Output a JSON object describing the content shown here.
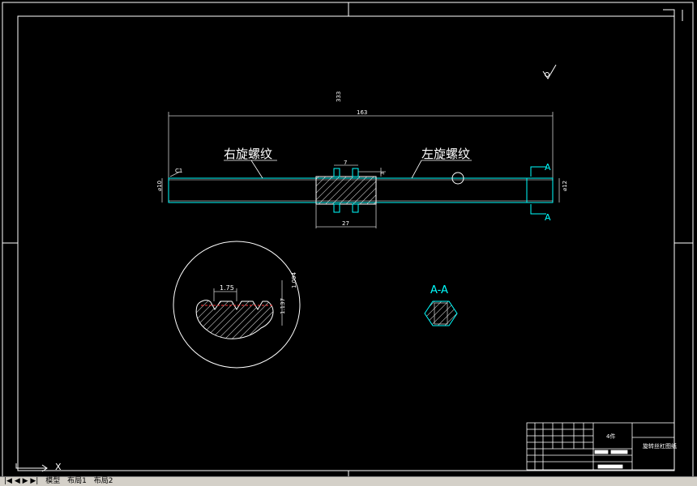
{
  "drawing": {
    "dimensions": {
      "overall": "333",
      "span": "163",
      "key_width": "7",
      "key_height": "3",
      "hex_length": "27",
      "left_diameter": "⌀10",
      "right_diameter": "⌀12",
      "chamfer": "C1",
      "thread_pitch": "1.75",
      "thread_depth_1": "1.094",
      "thread_depth_2": "1.137"
    },
    "labels": {
      "right_thread": "右旋螺纹",
      "left_thread": "左旋螺纹",
      "section_a_top": "A",
      "section_a_bottom": "A",
      "section_title": "A-A"
    },
    "title_block": {
      "part_name": "4件",
      "drawing_name": "旋转丝杠图纸"
    },
    "axis_marker": "X",
    "colors": {
      "geometry": "#ffffff",
      "dimension": "#00ffff",
      "thread_line": "#ff3333",
      "background": "#000000"
    }
  },
  "layout_tabs": {
    "nav": "|◀ ◀ ▶ ▶|",
    "items": [
      "模型",
      "布局1",
      "布局2"
    ]
  }
}
